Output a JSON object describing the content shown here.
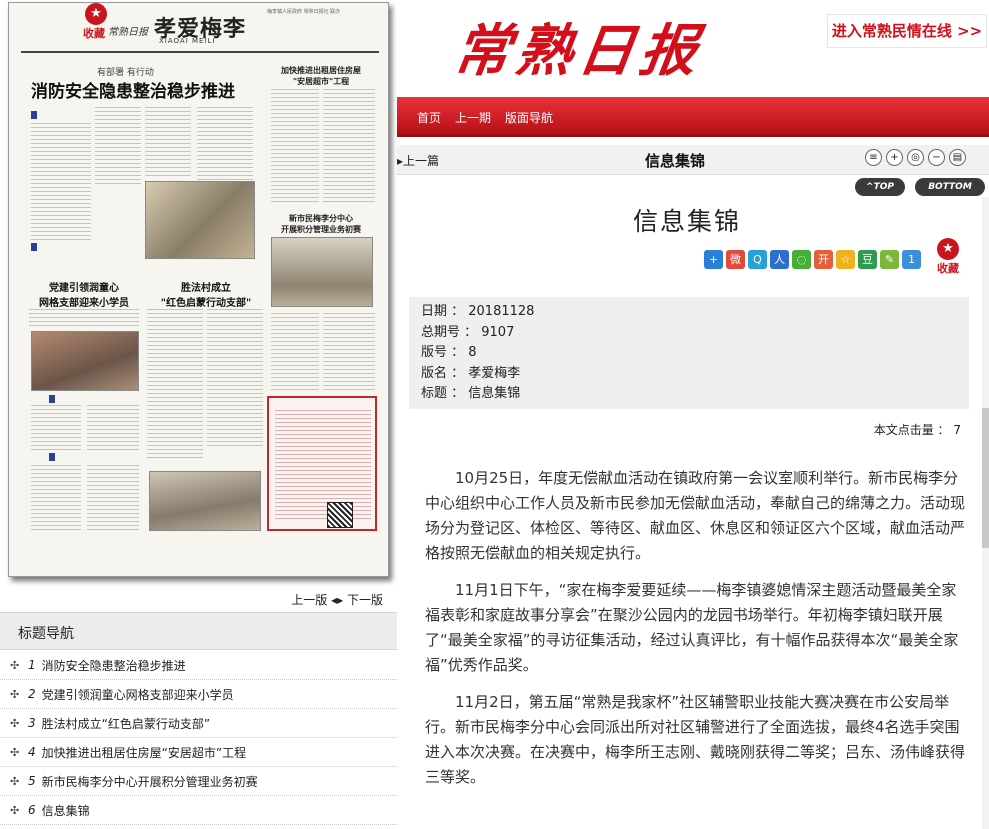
{
  "paper": {
    "fav_label": "收藏",
    "logo_small": "常熟日报",
    "page_title": "孝爱梅李",
    "page_subtitle": "XIAOAI MEILI",
    "meta_line": "梅李镇人民政府 常熟日报社 联办",
    "kicker1": "有部署 有行动",
    "headline1": "消防安全隐患整治稳步推进",
    "box_title1": "加快推进出租居住房屋\n\"安居超市\"工程",
    "headline2": "党建引领润童心\n网格支部迎来小学员",
    "headline3": "胜法村成立\n\"红色启蒙行动支部\"",
    "box_title2": "新市民梅李分中心\n开展积分管理业务初赛"
  },
  "paging": {
    "prev": "上一版",
    "next": "下一版"
  },
  "toc": {
    "title": "标题导航",
    "items": [
      {
        "num": "1",
        "title": "消防安全隐患整治稳步推进"
      },
      {
        "num": "2",
        "title": "党建引领润童心网格支部迎来小学员"
      },
      {
        "num": "3",
        "title": "胜法村成立“红色启蒙行动支部”"
      },
      {
        "num": "4",
        "title": "加快推进出租居住房屋“安居超市”工程"
      },
      {
        "num": "5",
        "title": "新市民梅李分中心开展积分管理业务初赛"
      },
      {
        "num": "6",
        "title": "信息集锦"
      }
    ]
  },
  "masthead": {
    "logo": "常熟日报",
    "cta": "进入常熟民情在线 >>"
  },
  "nav": {
    "home": "首页",
    "prev_issue": "上一期",
    "layout_nav": "版面导航"
  },
  "toolbar": {
    "prev": "▸上一篇",
    "section": "信息集锦",
    "top": "^TOP",
    "bottom": "BOTTOM"
  },
  "article": {
    "title": "信息集锦",
    "fav_label": "收藏",
    "meta": {
      "date": "日期 ： 20181128",
      "total": "总期号 ： 9107",
      "edition": "版号 ： 8",
      "edition_name": "版名 ： 孝爱梅李",
      "heading": "标题 ： 信息集锦"
    },
    "hits": "本文点击量 ： 7",
    "paragraphs": [
      "10月25日，年度无偿献血活动在镇政府第一会议室顺利举行。新市民梅李分中心组织中心工作人员及新市民参加无偿献血活动，奉献自己的绵薄之力。活动现场分为登记区、体检区、等待区、献血区、休息区和领证区六个区域，献血活动严格按照无偿献血的相关规定执行。",
      "11月1日下午，“家在梅李爱要延续——梅李镇婆媳情深主题活动暨最美全家福表彰和家庭故事分享会”在聚沙公园内的龙园书场举行。年初梅李镇妇联开展了“最美全家福”的寻访征集活动，经过认真评比，有十幅作品获得本次“最美全家福”优秀作品奖。",
      "11月2日，第五届“常熟是我家杯”社区辅警职业技能大赛决赛在市公安局举行。新市民梅李分中心会同派出所对社区辅警进行了全面选拔，最终4名选手突围进入本次决赛。在决赛中，梅李所王志刚、戴晓刚获得二等奖；吕东、汤伟峰获得三等奖。"
    ]
  },
  "colors": {
    "brand_red": "#d20f1a",
    "nav_red": "#c8151d"
  }
}
